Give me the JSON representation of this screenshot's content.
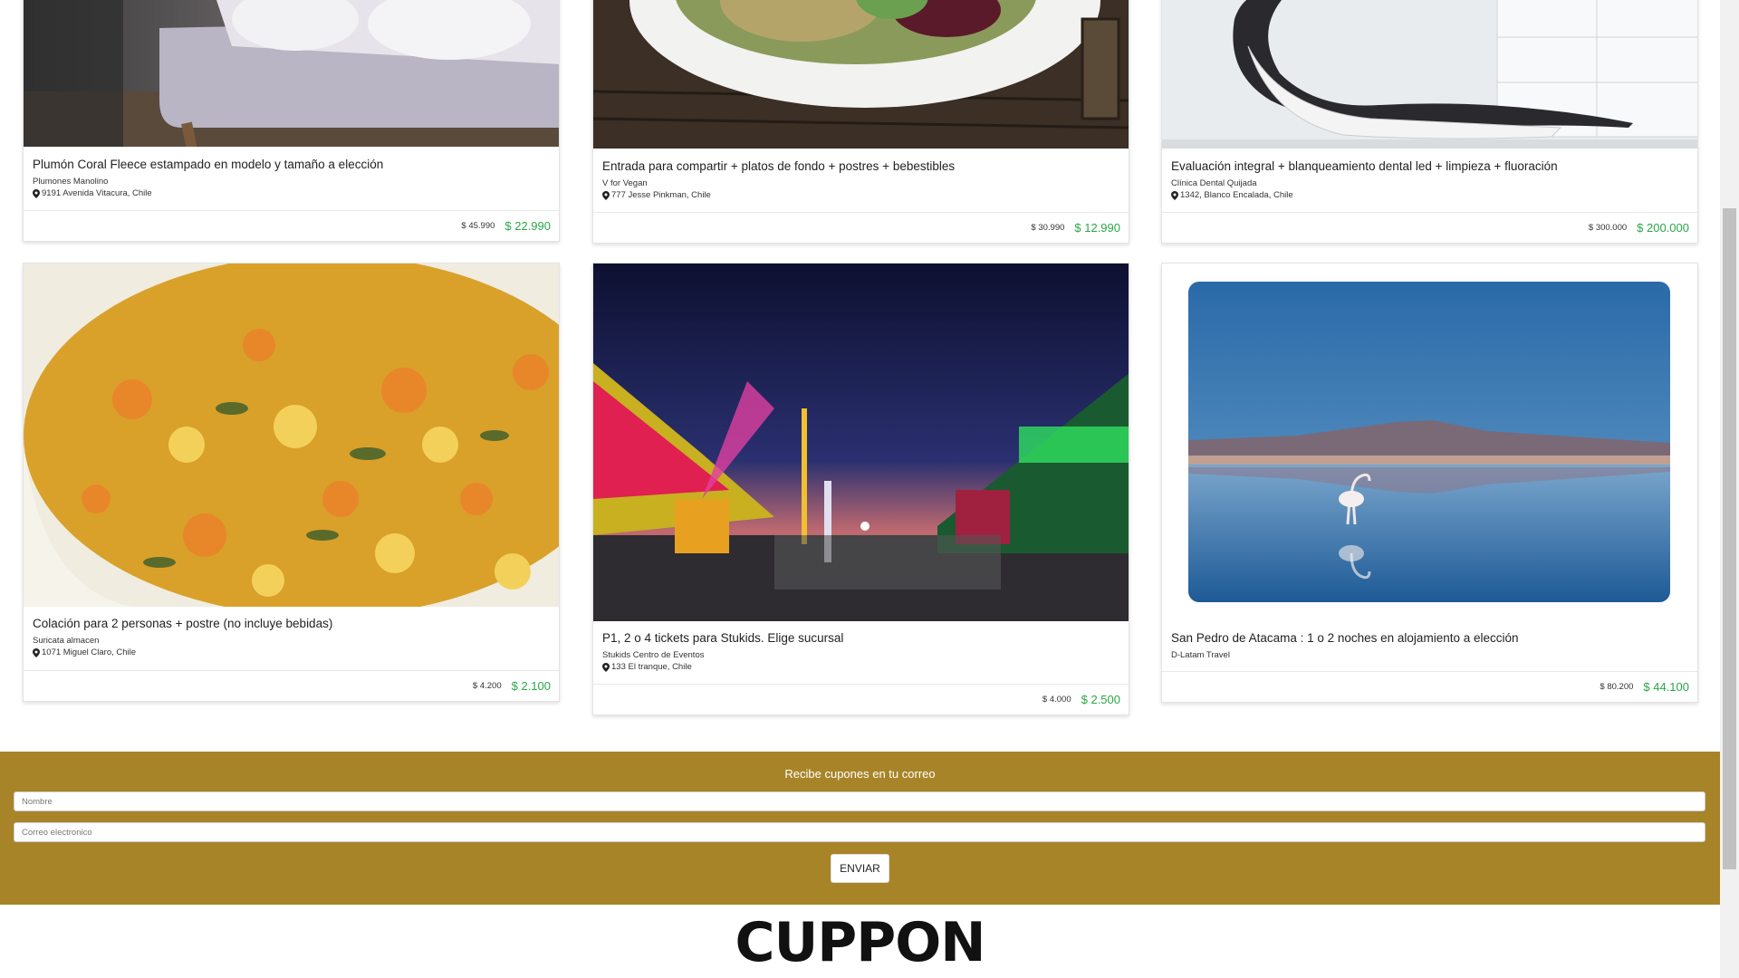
{
  "deals": [
    {
      "title": "Plumón Coral Fleece estampado en modelo y tamaño a elección",
      "merchant": "Plumones Manolino",
      "address": "9191 Avenida Vitacura, Chile",
      "old_price": "$ 45.990",
      "new_price": "$ 22.990",
      "image": "bedroom-photo"
    },
    {
      "title": "Entrada para compartir + platos de fondo + postres + bebestibles",
      "merchant": "V for Vegan",
      "address": "777 Jesse Pinkman, Chile",
      "old_price": "$ 30.990",
      "new_price": "$ 12.990",
      "image": "vegan-plate-photo"
    },
    {
      "title": "Evaluación integral + blanqueamiento dental led + limpieza + fluoración",
      "merchant": "Clínica Dental Quijada",
      "address": "1342, Blanco Encalada, Chile",
      "old_price": "$ 300.000",
      "new_price": "$ 200.000",
      "image": "dental-chair-photo"
    },
    {
      "title": "Colación para 2 personas + postre (no incluye bebidas)",
      "merchant": "Suricata almacen",
      "address": "1071 Miguel Claro, Chile",
      "old_price": "$ 4.200",
      "new_price": "$ 2.100",
      "image": "food-stew-photo"
    },
    {
      "title": "P1, 2 o 4 tickets para Stukids. Elige sucursal",
      "merchant": "Stukids Centro de Eventos",
      "address": "133 El tranque, Chile",
      "old_price": "$ 4.000",
      "new_price": "$ 2.500",
      "image": "fair-night-photo"
    },
    {
      "title": "San Pedro de Atacama : 1 o 2 noches en alojamiento a elección",
      "merchant": "D-Latam Travel",
      "address": "",
      "old_price": "$ 80.200",
      "new_price": "$ 44.100",
      "image": "flamingo-lake-photo"
    }
  ],
  "newsletter": {
    "title": "Recibe cupones en tu correo",
    "name_placeholder": "Nombre",
    "email_placeholder": "Correo electronico",
    "submit_label": "ENVIAR"
  },
  "footer": {
    "logo": "CUPPON"
  },
  "colors": {
    "accent": "#a88428",
    "price_green": "#28a745"
  }
}
